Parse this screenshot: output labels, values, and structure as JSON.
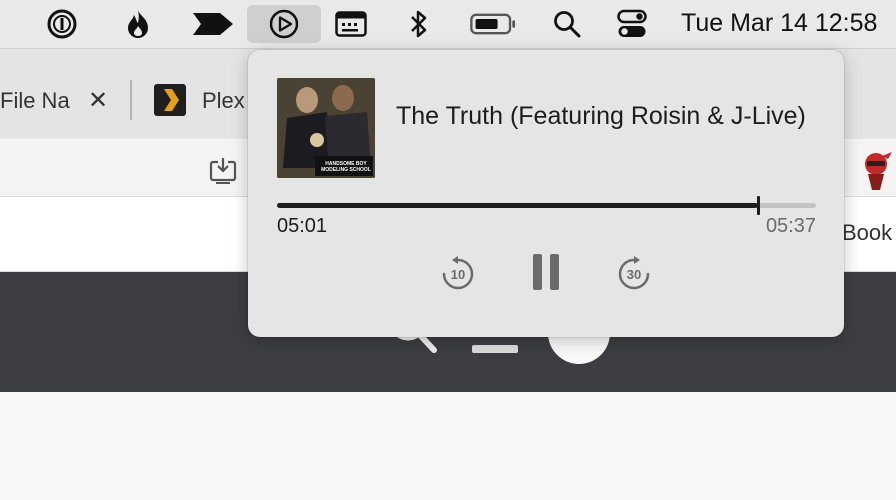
{
  "menubar": {
    "icons": [
      "password-manager-icon",
      "flame-icon",
      "arrow-icon",
      "play-circle-icon",
      "keyboard-icon",
      "bluetooth-icon",
      "battery-icon",
      "search-icon",
      "control-center-icon"
    ],
    "clock": "Tue Mar 14  12:58"
  },
  "browser": {
    "tabs": [
      {
        "label": "File Na"
      },
      {
        "label": "Plex"
      }
    ],
    "bookmark_label": "Book"
  },
  "now_playing": {
    "title": "The Truth (Featuring Roisin & J-Live)",
    "album_art_text": [
      "HANDSOME BOY",
      "MODELING SCHOOL"
    ],
    "elapsed": "05:01",
    "duration": "05:37",
    "progress_fraction": 0.893,
    "skip_back_seconds": "10",
    "skip_forward_seconds": "30"
  },
  "colors": {
    "menubar_bg": "#e9e9e9",
    "popover_bg": "#e5e5e5",
    "progress": "#1e1e1e",
    "plex_orange": "#e5a00d"
  }
}
